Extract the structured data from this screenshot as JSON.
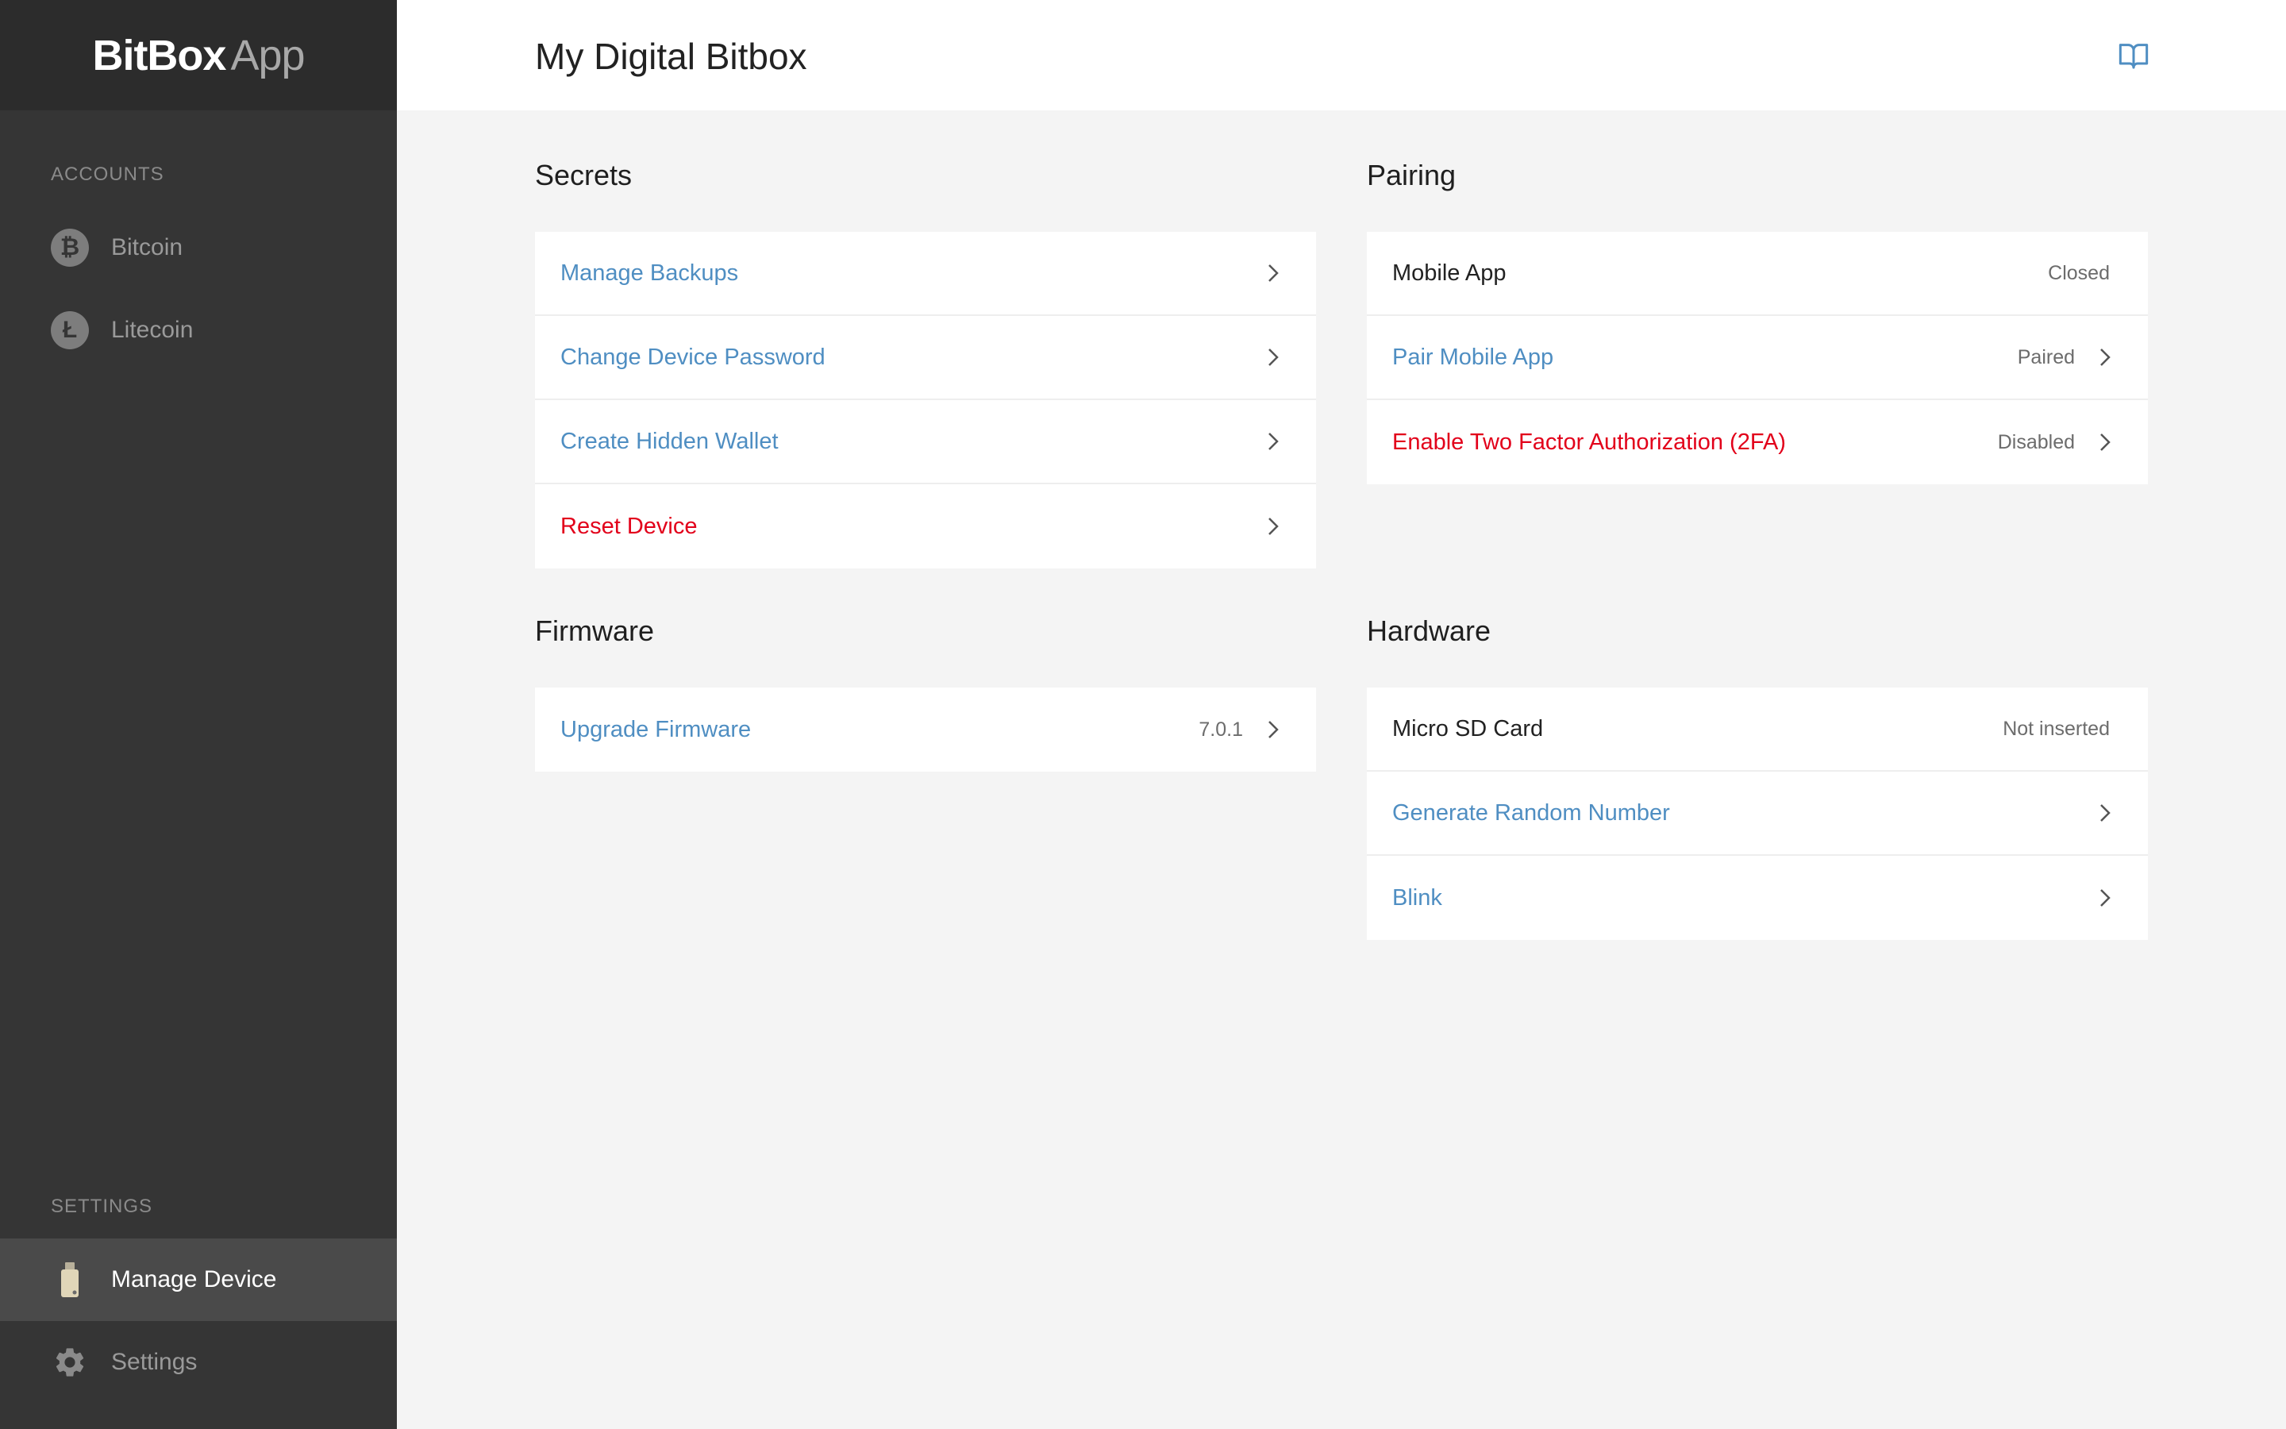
{
  "sidebar": {
    "brand_bold": "BitBox",
    "brand_light": "App",
    "accounts_label": "ACCOUNTS",
    "accounts": [
      {
        "label": "Bitcoin",
        "icon": "bitcoin-icon",
        "glyph": "₿"
      },
      {
        "label": "Litecoin",
        "icon": "litecoin-icon",
        "glyph": "Ł"
      }
    ],
    "settings_label": "SETTINGS",
    "settings_items": [
      {
        "label": "Manage Device",
        "icon": "usb-device-icon",
        "active": true
      },
      {
        "label": "Settings",
        "icon": "gear-icon",
        "active": false
      }
    ]
  },
  "header": {
    "title": "My Digital Bitbox",
    "guide_icon": "book-icon"
  },
  "sections": {
    "secrets": {
      "title": "Secrets",
      "rows": [
        {
          "label": "Manage Backups",
          "style": "link"
        },
        {
          "label": "Change Device Password",
          "style": "link"
        },
        {
          "label": "Create Hidden Wallet",
          "style": "link"
        },
        {
          "label": "Reset Device",
          "style": "danger"
        }
      ]
    },
    "pairing": {
      "title": "Pairing",
      "rows": [
        {
          "label": "Mobile App",
          "value": "Closed",
          "style": "plain"
        },
        {
          "label": "Pair Mobile App",
          "value": "Paired",
          "style": "link"
        },
        {
          "label": "Enable Two Factor Authorization (2FA)",
          "value": "Disabled",
          "style": "danger"
        }
      ]
    },
    "firmware": {
      "title": "Firmware",
      "rows": [
        {
          "label": "Upgrade Firmware",
          "value": "7.0.1",
          "style": "link"
        }
      ]
    },
    "hardware": {
      "title": "Hardware",
      "rows": [
        {
          "label": "Micro SD Card",
          "value": "Not inserted",
          "style": "plain"
        },
        {
          "label": "Generate Random Number",
          "style": "link"
        },
        {
          "label": "Blink",
          "style": "link"
        }
      ]
    }
  },
  "colors": {
    "sidebar_bg": "#353535",
    "brand_bg": "#2c2c2c",
    "active_bg": "#4a4a4a",
    "link": "#4f8ec2",
    "danger": "#e2001a",
    "content_bg": "#f4f4f4"
  }
}
